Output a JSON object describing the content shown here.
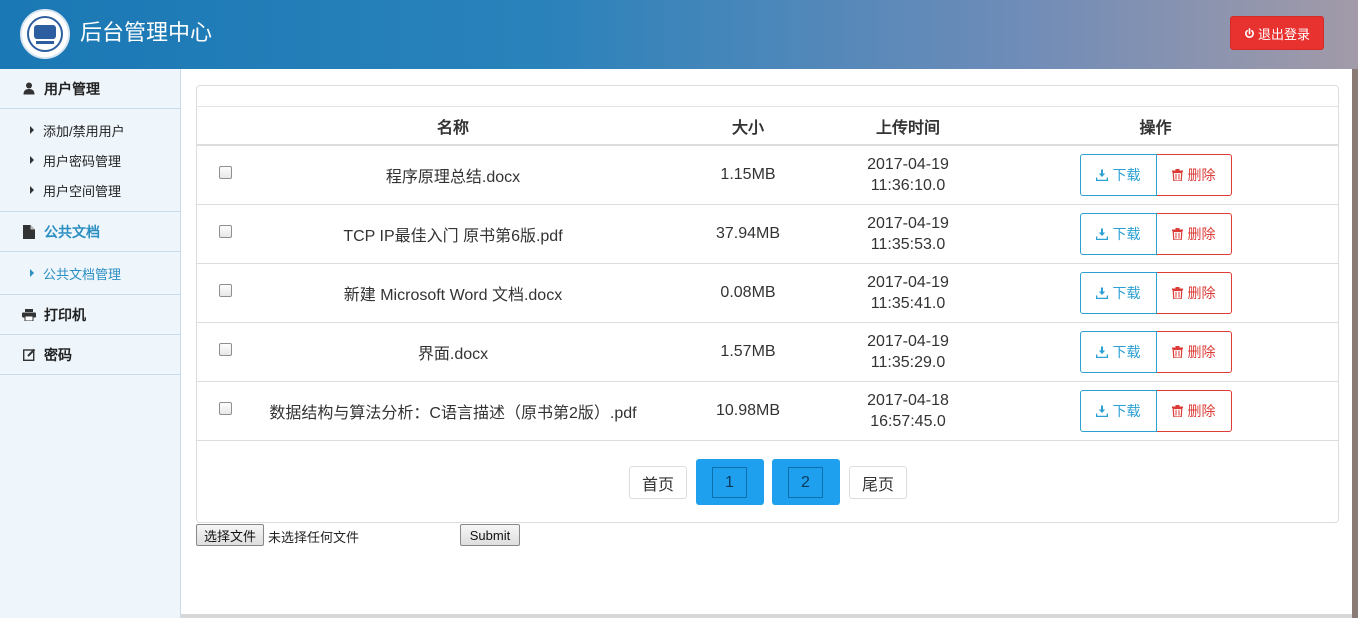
{
  "header": {
    "app_title": "后台管理中心",
    "logout_label": "退出登录"
  },
  "sidebar": {
    "sections": [
      {
        "label": "用户管理",
        "icon": "user-icon"
      },
      {
        "label": "公共文档",
        "icon": "document-icon"
      },
      {
        "label": "打印机",
        "icon": "printer-icon"
      },
      {
        "label": "密码",
        "icon": "edit-icon"
      }
    ],
    "user_items": [
      {
        "label": "添加/禁用用户"
      },
      {
        "label": "用户密码管理"
      },
      {
        "label": "用户空间管理"
      }
    ],
    "doc_items": [
      {
        "label": "公共文档管理"
      }
    ]
  },
  "table": {
    "headers": {
      "name": "名称",
      "size": "大小",
      "time": "上传时间",
      "ops": "操作"
    },
    "download_label": "下载",
    "delete_label": "删除",
    "rows": [
      {
        "name": "程序原理总结.docx",
        "size": "1.15MB",
        "date": "2017-04-19",
        "time": "11:36:10.0"
      },
      {
        "name": "TCP IP最佳入门 原书第6版.pdf",
        "size": "37.94MB",
        "date": "2017-04-19",
        "time": "11:35:53.0"
      },
      {
        "name": "新建 Microsoft Word 文档.docx",
        "size": "0.08MB",
        "date": "2017-04-19",
        "time": "11:35:41.0"
      },
      {
        "name": "界面.docx",
        "size": "1.57MB",
        "date": "2017-04-19",
        "time": "11:35:29.0"
      },
      {
        "name": "数据结构与算法分析：C语言描述（原书第2版）.pdf",
        "size": "10.98MB",
        "date": "2017-04-18",
        "time": "16:57:45.0"
      }
    ]
  },
  "pagination": {
    "first": "首页",
    "pages": [
      "1",
      "2"
    ],
    "last": "尾页"
  },
  "upload": {
    "choose_label": "选择文件",
    "status": "未选择任何文件",
    "submit_label": "Submit"
  },
  "colors": {
    "accent": "#2aa0d3",
    "danger": "#dc3b36",
    "logout": "#e8322f",
    "pager_active": "#1ea0ee"
  }
}
